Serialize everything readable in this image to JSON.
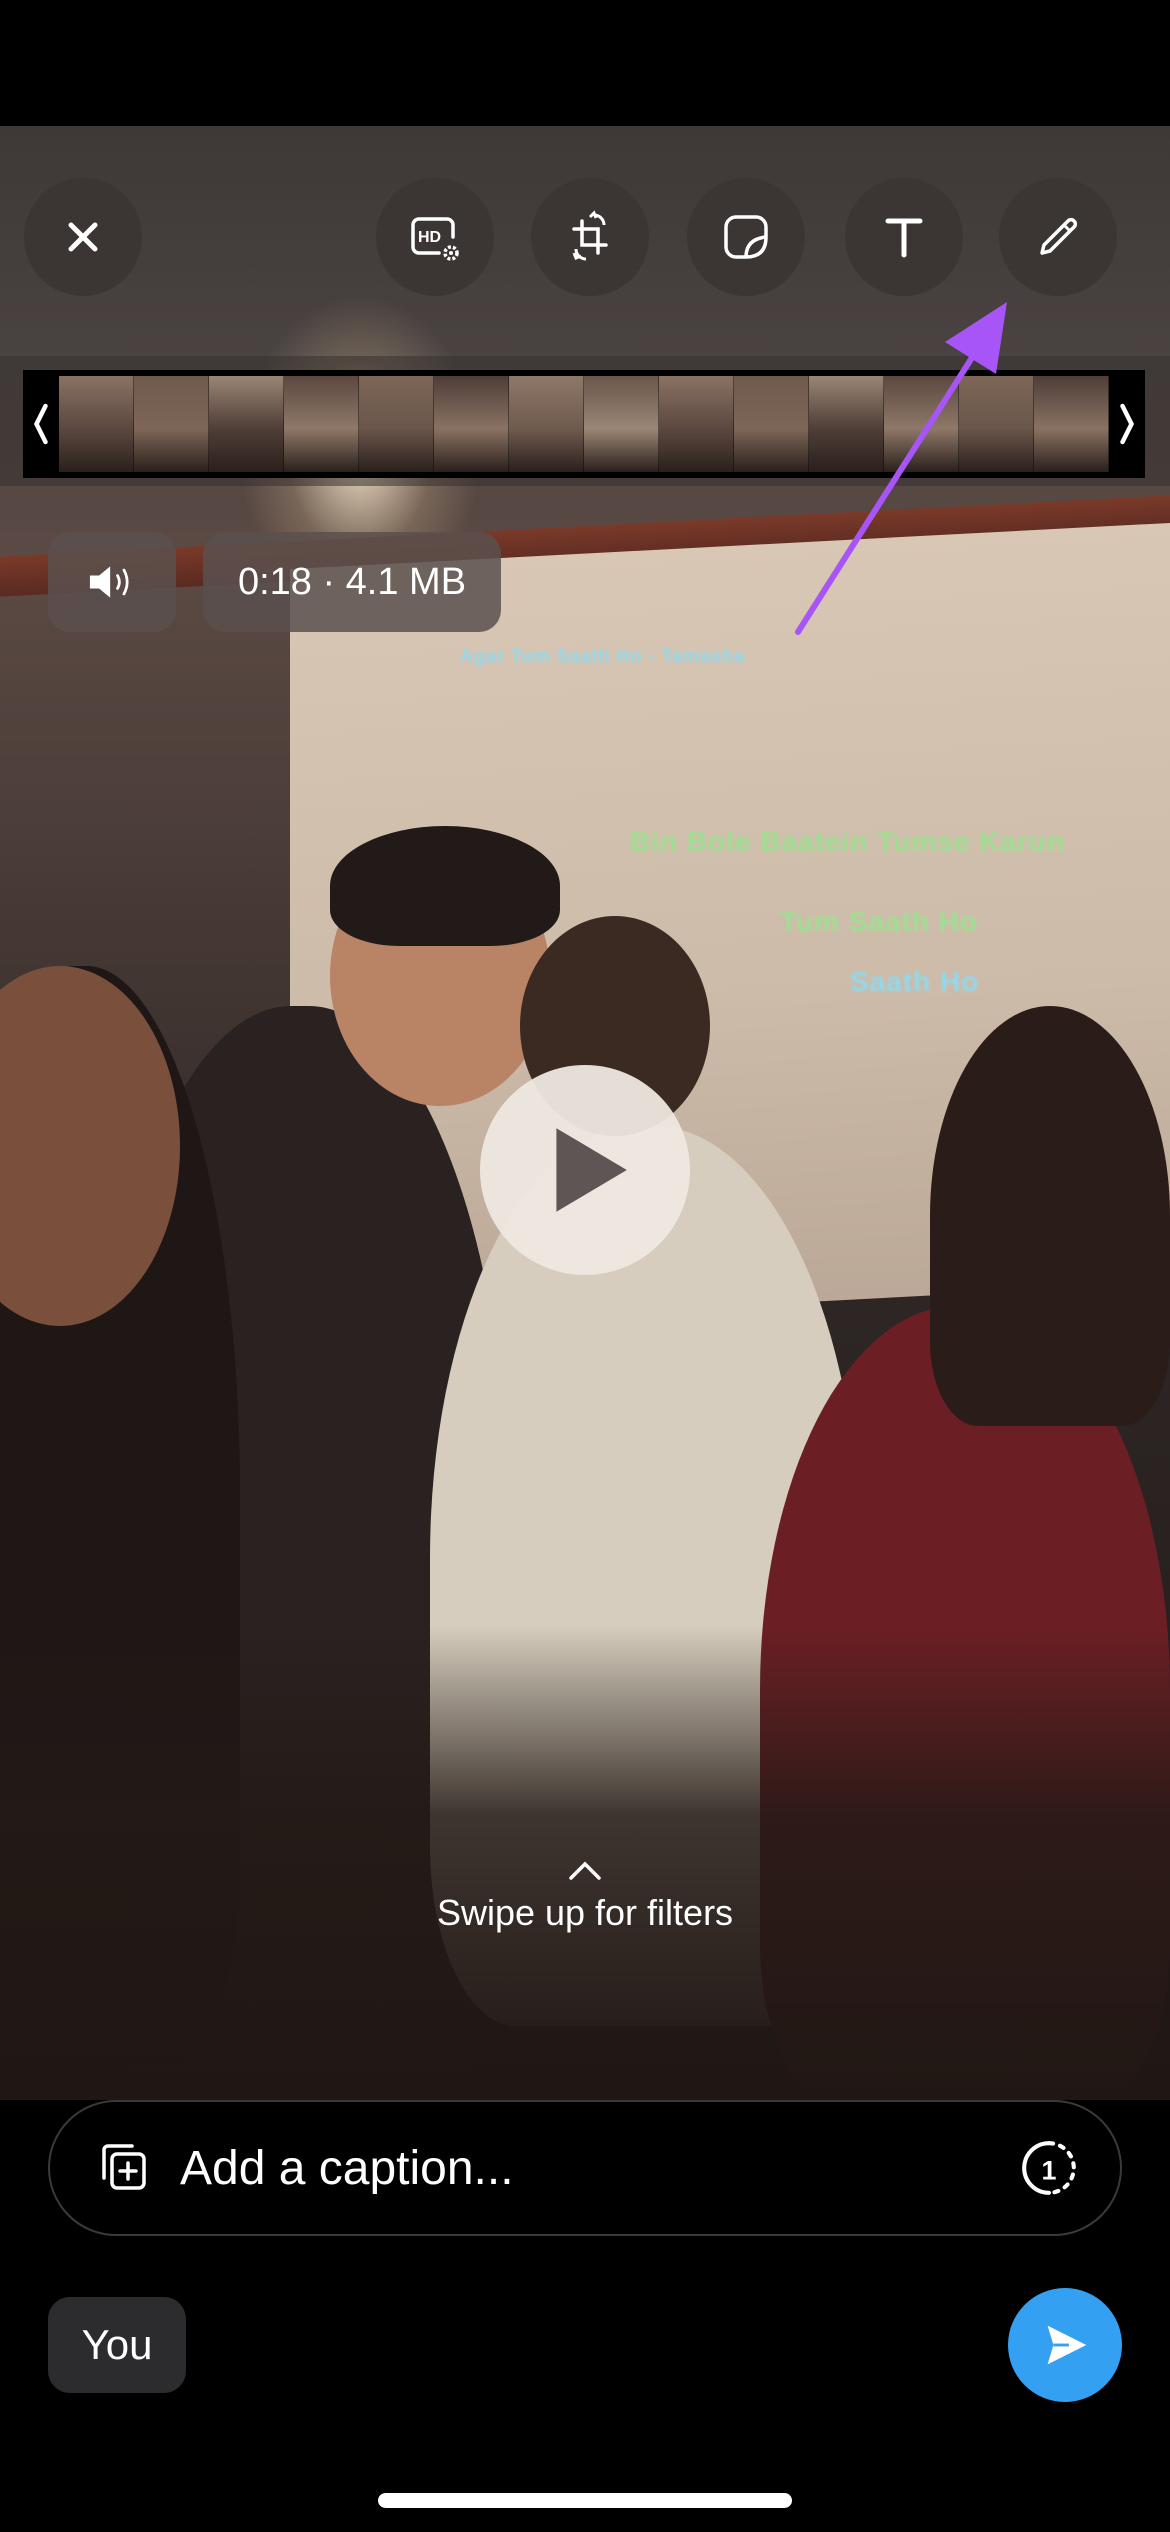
{
  "app": {
    "screen": "Video editor"
  },
  "toolbar": {
    "close": {
      "icon": "close-icon"
    },
    "tools": [
      {
        "id": "hd-quality",
        "icon": "hd-settings-icon",
        "label": "HD"
      },
      {
        "id": "crop-rotate",
        "icon": "crop-rotate-icon"
      },
      {
        "id": "sticker",
        "icon": "sticker-icon"
      },
      {
        "id": "text",
        "icon": "text-icon",
        "label": "T"
      },
      {
        "id": "draw",
        "icon": "pencil-icon"
      }
    ]
  },
  "trimmer": {
    "left_handle": "‹",
    "right_handle": "›",
    "frame_count": 14
  },
  "media_info": {
    "sound_icon": "speaker-icon",
    "duration": "0:18",
    "separator": "·",
    "size": "4.1 MB",
    "summary": "0:18 · 4.1 MB"
  },
  "video": {
    "play_icon": "play-icon",
    "lyrics": {
      "header": "Agar Tum Saath Ho - Tamasha",
      "line1": "Bin Bole Baatein Tumse Karun",
      "line2": "Tum Saath Ho",
      "line3": "Saath Ho"
    }
  },
  "filters_hint": {
    "icon": "chevron-up-icon",
    "label": "Swipe up for filters"
  },
  "caption": {
    "add_media_icon": "add-media-icon",
    "placeholder": "Add a caption...",
    "value": "",
    "view_once_icon": "view-once-icon",
    "view_once_label": "1"
  },
  "recipient": {
    "label": "You"
  },
  "send": {
    "icon": "send-icon"
  },
  "annotation": {
    "type": "arrow",
    "color": "#A855F7",
    "target": "draw tool"
  },
  "colors": {
    "send_button": "#34A0F2",
    "tool_button_bg": "#3A3432",
    "annotation_arrow": "#A855F7"
  }
}
